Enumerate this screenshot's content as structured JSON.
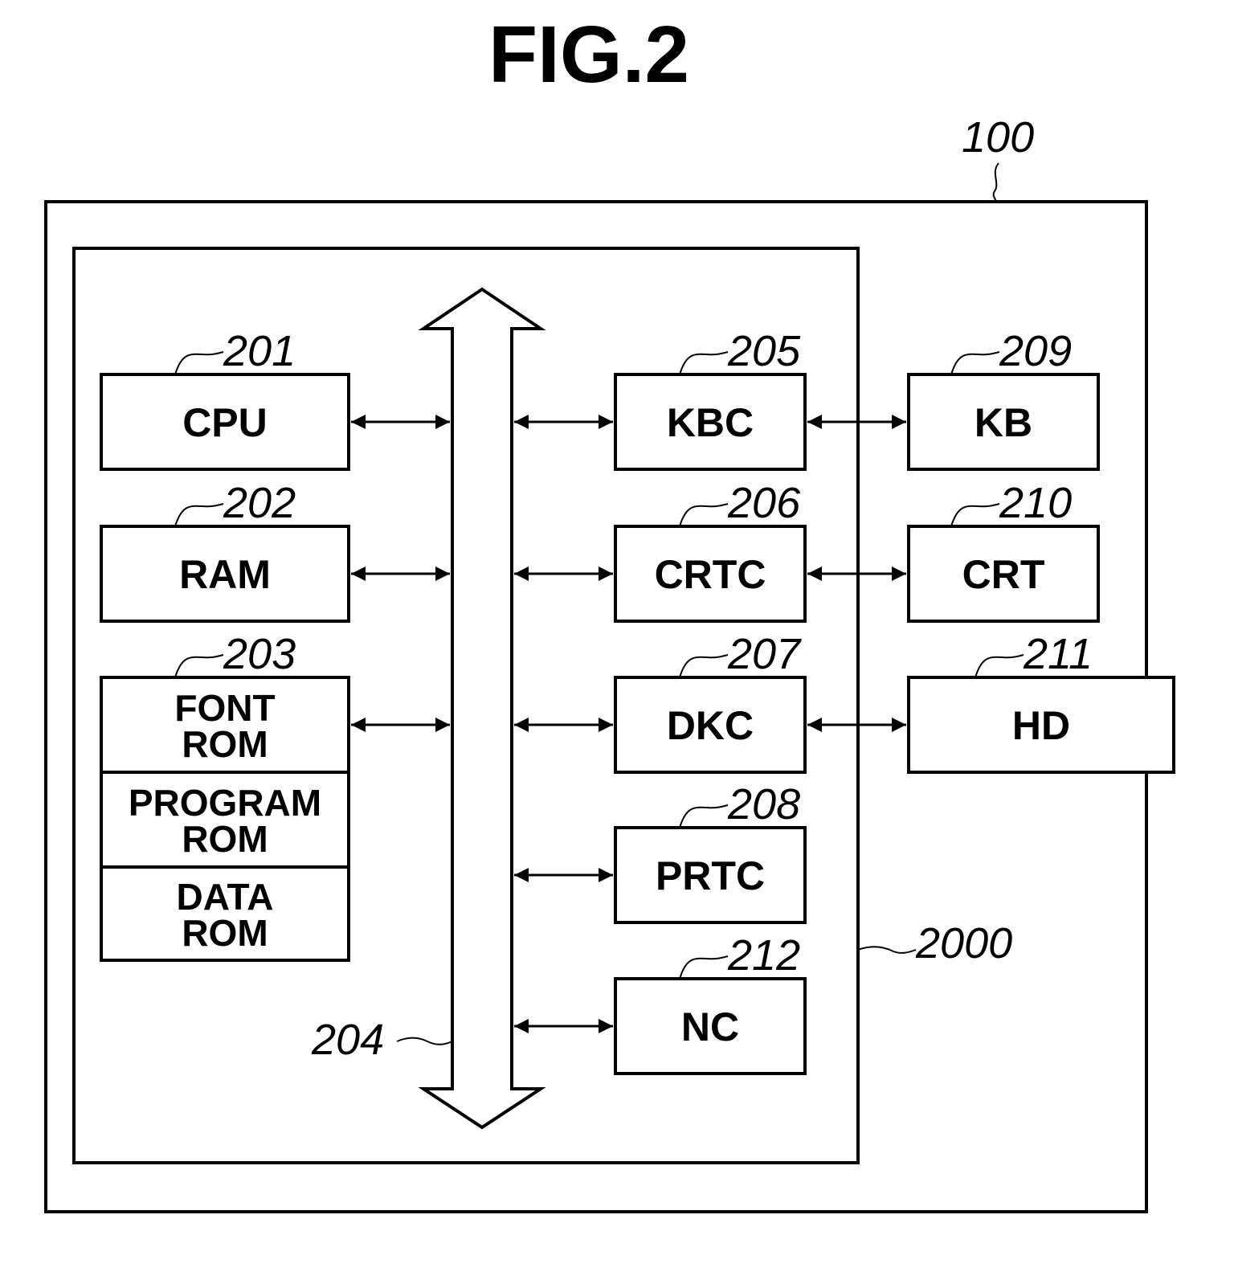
{
  "figure": {
    "title": "FIG.2",
    "outer_system": {
      "ref": "100"
    },
    "controller_unit": {
      "ref": "2000"
    },
    "bus": {
      "ref": "204"
    },
    "left_blocks": [
      {
        "id": "cpu",
        "ref": "201",
        "lines": [
          "CPU"
        ]
      },
      {
        "id": "ram",
        "ref": "202",
        "lines": [
          "RAM"
        ]
      }
    ],
    "rom_stack": {
      "ref": "203",
      "sections": [
        {
          "id": "font-rom",
          "lines": [
            "FONT",
            "ROM"
          ]
        },
        {
          "id": "program-rom",
          "lines": [
            "PROGRAM",
            "ROM"
          ]
        },
        {
          "id": "data-rom",
          "lines": [
            "DATA",
            "ROM"
          ]
        }
      ]
    },
    "controllers": [
      {
        "id": "kbc",
        "ref": "205",
        "label": "KBC"
      },
      {
        "id": "crtc",
        "ref": "206",
        "label": "CRTC"
      },
      {
        "id": "dkc",
        "ref": "207",
        "label": "DKC"
      },
      {
        "id": "prtc",
        "ref": "208",
        "label": "PRTC"
      },
      {
        "id": "nc",
        "ref": "212",
        "label": "NC"
      }
    ],
    "devices": [
      {
        "id": "kb",
        "ref": "209",
        "label": "KB"
      },
      {
        "id": "crt",
        "ref": "210",
        "label": "CRT"
      },
      {
        "id": "hd",
        "ref": "211",
        "label": "HD"
      }
    ]
  }
}
